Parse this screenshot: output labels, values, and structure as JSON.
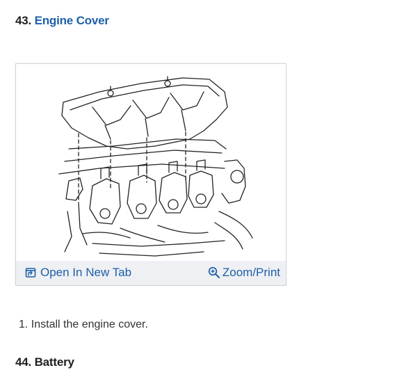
{
  "steps": [
    {
      "number": "43.",
      "title": "Engine Cover"
    },
    {
      "number": "44.",
      "title": "Battery"
    }
  ],
  "figure": {
    "open_label": "Open In New Tab",
    "zoom_label": "Zoom/Print",
    "open_icon": "open-in-new-tab-icon",
    "zoom_icon": "magnifier-plus-icon"
  },
  "instructions": [
    {
      "num": "1.",
      "text": "Install the engine cover."
    }
  ],
  "colors": {
    "link": "#1d5fa8",
    "toolbar_bg": "#eef0f3",
    "text": "#333333"
  }
}
